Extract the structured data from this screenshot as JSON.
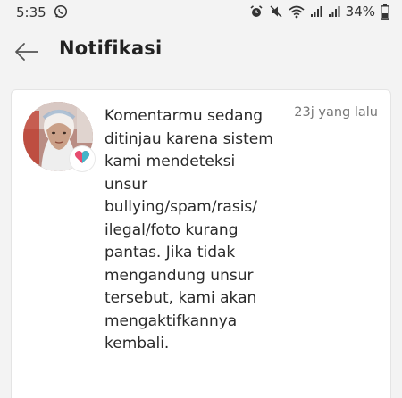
{
  "statusbar": {
    "time": "5:35",
    "battery": "34%"
  },
  "appbar": {
    "title": "Notifikasi"
  },
  "notification": {
    "message": "Komentarmu sedang ditinjau karena sistem kami mendeteksi unsur bullying/spam/rasis/ ilegal/foto kurang pantas. Jika tidak mengandung unsur tersebut, kami akan mengaktifkannya kembali.",
    "time": "23j yang lalu",
    "badge_color": "#e74c6f"
  },
  "icons": {
    "status_left": "whatsapp-icon",
    "status_right": [
      "alarm-icon",
      "mute-icon",
      "wifi-icon",
      "signal-icon",
      "signal-icon",
      "battery-icon"
    ],
    "back": "arrow-left-icon",
    "badge": "heart-icon"
  }
}
